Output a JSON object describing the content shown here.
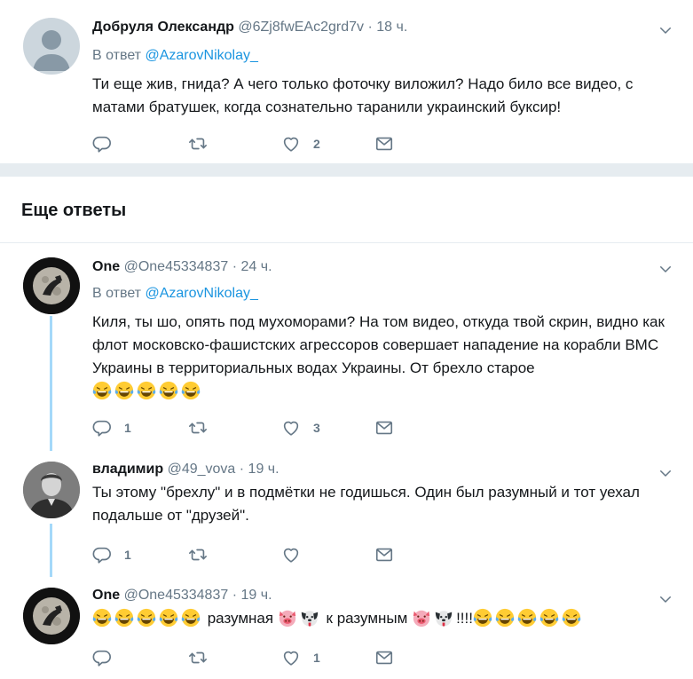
{
  "tweets": [
    {
      "name": "Добруля Олександр",
      "handle": "@6Zj8fwEAc2grd7v",
      "time": "18 ч.",
      "reply_label": "В ответ",
      "reply_to": "@AzarovNikolay_",
      "text": "Ти еще жив, гнида? А чего только фоточку виложил? Надо било все видео, с матами братушек, когда сознательно таранили украинский буксир!",
      "reply_count": "",
      "like_count": "2"
    },
    {
      "name": "One",
      "handle": "@One45334837",
      "time": "24 ч.",
      "reply_label": "В ответ",
      "reply_to": "@AzarovNikolay_",
      "text": "Киля, ты шо, опять под мухоморами? На том видео, откуда твой скрин, видно как флот московско-фашистских агрессоров совершает нападение на корабли ВМС Украины в территориальных водах Украины. От брехло старое",
      "reply_count": "1",
      "like_count": "3"
    },
    {
      "name": "владимир",
      "handle": "@49_vova",
      "time": "19 ч.",
      "text": "Ты этому \"брехлу\" и в подмётки не годишься. Один был разумный и тот уехал подальше от \"друзей\".",
      "reply_count": "1",
      "like_count": ""
    },
    {
      "name": "One",
      "handle": "@One45334837",
      "time": "19 ч.",
      "text_mid": " разумная ",
      "text_mid2": " к разумным ",
      "text_end": "!!!!",
      "reply_count": "",
      "like_count": "1"
    }
  ],
  "section_title": "Еще ответы",
  "dot": "·",
  "icons": [
    "reply-icon",
    "retweet-icon",
    "like-icon",
    "message-icon",
    "chevron-down-icon"
  ],
  "colors": {
    "mention": "#1b95e0",
    "gray": "#657786",
    "thread_line": "#a4d9f9"
  }
}
